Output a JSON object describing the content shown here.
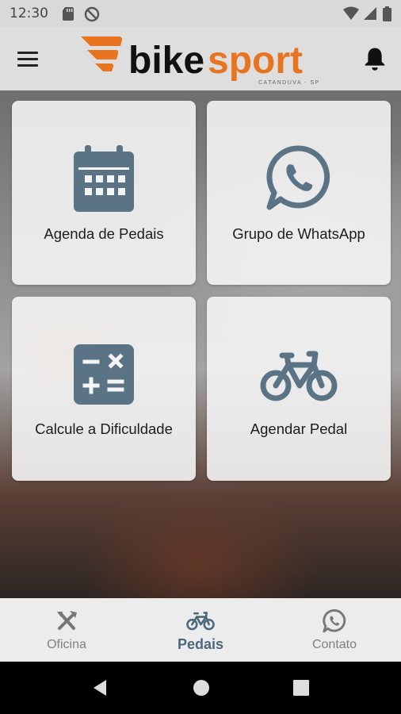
{
  "status_bar": {
    "time": "12:30"
  },
  "header": {
    "logo_text_dark": "bike",
    "logo_text_orange": "sport",
    "logo_subtitle": "CATANDUVA - SP"
  },
  "cards": [
    {
      "label": "Agenda de Pedais",
      "icon": "calendar-icon"
    },
    {
      "label": "Grupo de WhatsApp",
      "icon": "whatsapp-icon"
    },
    {
      "label": "Calcule a Dificuldade",
      "icon": "calculator-icon"
    },
    {
      "label": "Agendar Pedal",
      "icon": "bicycle-icon"
    }
  ],
  "bottom_nav": {
    "active": "Pedais",
    "items": [
      {
        "label": "Oficina",
        "icon": "tools-icon"
      },
      {
        "label": "Pedais",
        "icon": "bicycle-icon"
      },
      {
        "label": "Contato",
        "icon": "whatsapp-icon"
      }
    ]
  },
  "colors": {
    "accent": "#4c687c",
    "brand_orange": "#e8741f",
    "icon_slate": "#5a7486",
    "appbar": "#dedede"
  }
}
